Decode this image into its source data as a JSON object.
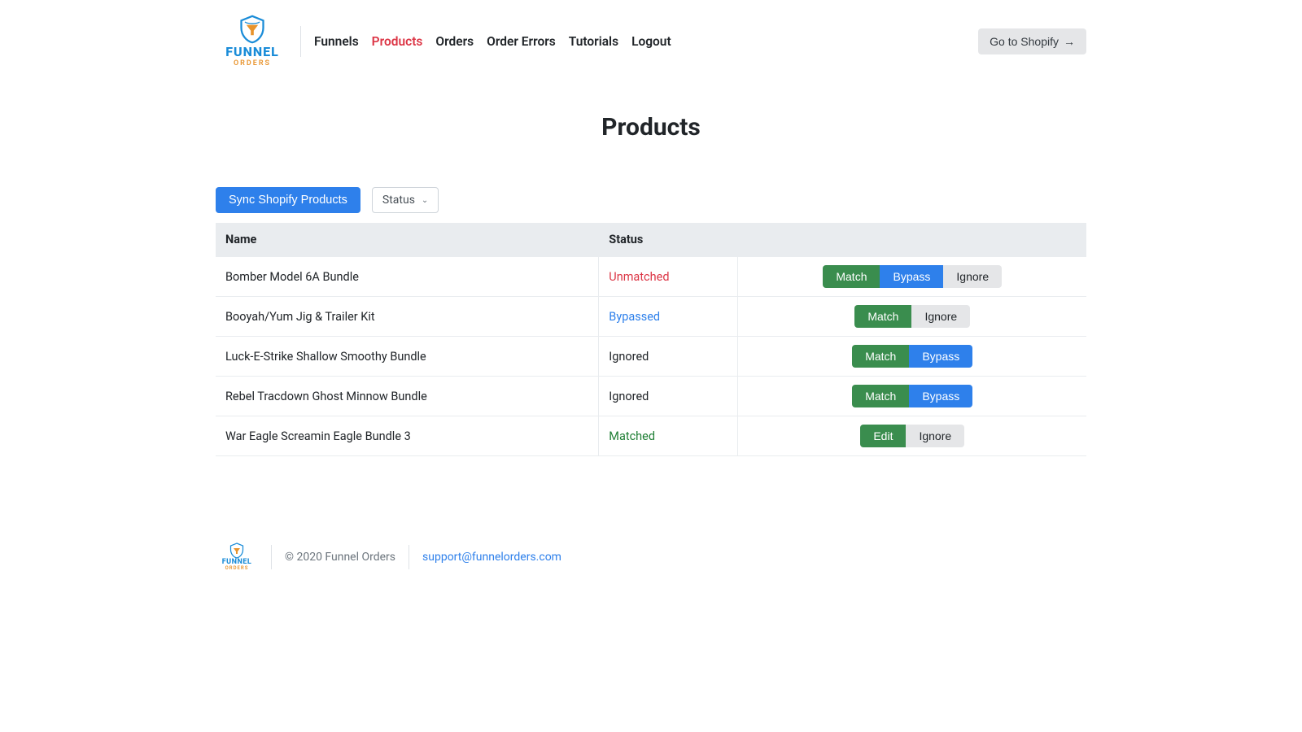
{
  "logo": {
    "top": "FUNNEL",
    "bottom": "ORDERS"
  },
  "nav": {
    "items": [
      {
        "label": "Funnels",
        "active": false
      },
      {
        "label": "Products",
        "active": true
      },
      {
        "label": "Orders",
        "active": false
      },
      {
        "label": "Order Errors",
        "active": false
      },
      {
        "label": "Tutorials",
        "active": false
      },
      {
        "label": "Logout",
        "active": false
      }
    ]
  },
  "header": {
    "shopify_button": "Go to Shopify"
  },
  "page": {
    "title": "Products"
  },
  "actions": {
    "sync_button": "Sync Shopify Products",
    "status_filter": "Status"
  },
  "table": {
    "headers": {
      "name": "Name",
      "status": "Status"
    },
    "rows": [
      {
        "name": "Bomber Model 6A Bundle",
        "status": "Unmatched",
        "status_class": "unmatched",
        "actions": [
          {
            "label": "Match",
            "style": "green"
          },
          {
            "label": "Bypass",
            "style": "blue"
          },
          {
            "label": "Ignore",
            "style": "gray"
          }
        ]
      },
      {
        "name": "Booyah/Yum Jig & Trailer Kit",
        "status": "Bypassed",
        "status_class": "bypassed",
        "actions": [
          {
            "label": "Match",
            "style": "green"
          },
          {
            "label": "Ignore",
            "style": "gray"
          }
        ]
      },
      {
        "name": "Luck-E-Strike Shallow Smoothy Bundle",
        "status": "Ignored",
        "status_class": "ignored",
        "actions": [
          {
            "label": "Match",
            "style": "green"
          },
          {
            "label": "Bypass",
            "style": "blue"
          }
        ]
      },
      {
        "name": "Rebel Tracdown Ghost Minnow Bundle",
        "status": "Ignored",
        "status_class": "ignored",
        "actions": [
          {
            "label": "Match",
            "style": "green"
          },
          {
            "label": "Bypass",
            "style": "blue"
          }
        ]
      },
      {
        "name": "War Eagle Screamin Eagle Bundle 3",
        "status": "Matched",
        "status_class": "matched",
        "actions": [
          {
            "label": "Edit",
            "style": "green"
          },
          {
            "label": "Ignore",
            "style": "gray"
          }
        ]
      }
    ]
  },
  "footer": {
    "copyright": "© 2020 Funnel Orders",
    "email": "support@funnelorders.com"
  }
}
